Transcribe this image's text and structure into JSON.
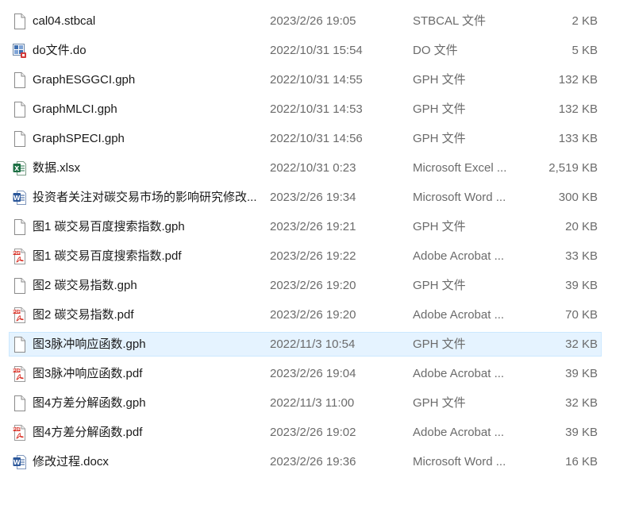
{
  "files": [
    {
      "name": "cal04.stbcal",
      "date": "2023/2/26 19:05",
      "type": "STBCAL 文件",
      "size": "2 KB",
      "icon": "generic-file-icon",
      "selected": false
    },
    {
      "name": "do文件.do",
      "date": "2022/10/31 15:54",
      "type": "DO 文件",
      "size": "5 KB",
      "icon": "stata-do-file-icon",
      "selected": false
    },
    {
      "name": "GraphESGGCI.gph",
      "date": "2022/10/31 14:55",
      "type": "GPH 文件",
      "size": "132 KB",
      "icon": "generic-file-icon",
      "selected": false
    },
    {
      "name": "GraphMLCI.gph",
      "date": "2022/10/31 14:53",
      "type": "GPH 文件",
      "size": "132 KB",
      "icon": "generic-file-icon",
      "selected": false
    },
    {
      "name": "GraphSPECI.gph",
      "date": "2022/10/31 14:56",
      "type": "GPH 文件",
      "size": "133 KB",
      "icon": "generic-file-icon",
      "selected": false
    },
    {
      "name": "数据.xlsx",
      "date": "2022/10/31 0:23",
      "type": "Microsoft Excel ...",
      "size": "2,519 KB",
      "icon": "excel-file-icon",
      "selected": false
    },
    {
      "name": "投资者关注对碳交易市场的影响研究修改...",
      "date": "2023/2/26 19:34",
      "type": "Microsoft Word ...",
      "size": "300 KB",
      "icon": "word-file-icon",
      "selected": false
    },
    {
      "name": "图1 碳交易百度搜索指数.gph",
      "date": "2023/2/26 19:21",
      "type": "GPH 文件",
      "size": "20 KB",
      "icon": "generic-file-icon",
      "selected": false
    },
    {
      "name": "图1 碳交易百度搜索指数.pdf",
      "date": "2023/2/26 19:22",
      "type": "Adobe Acrobat ...",
      "size": "33 KB",
      "icon": "pdf-file-icon",
      "selected": false
    },
    {
      "name": "图2 碳交易指数.gph",
      "date": "2023/2/26 19:20",
      "type": "GPH 文件",
      "size": "39 KB",
      "icon": "generic-file-icon",
      "selected": false
    },
    {
      "name": "图2 碳交易指数.pdf",
      "date": "2023/2/26 19:20",
      "type": "Adobe Acrobat ...",
      "size": "70 KB",
      "icon": "pdf-file-icon",
      "selected": false
    },
    {
      "name": "图3脉冲响应函数.gph",
      "date": "2022/11/3 10:54",
      "type": "GPH 文件",
      "size": "32 KB",
      "icon": "generic-file-icon",
      "selected": true
    },
    {
      "name": "图3脉冲响应函数.pdf",
      "date": "2023/2/26 19:04",
      "type": "Adobe Acrobat ...",
      "size": "39 KB",
      "icon": "pdf-file-icon",
      "selected": false
    },
    {
      "name": "图4方差分解函数.gph",
      "date": "2022/11/3 11:00",
      "type": "GPH 文件",
      "size": "32 KB",
      "icon": "generic-file-icon",
      "selected": false
    },
    {
      "name": "图4方差分解函数.pdf",
      "date": "2023/2/26 19:02",
      "type": "Adobe Acrobat ...",
      "size": "39 KB",
      "icon": "pdf-file-icon",
      "selected": false
    },
    {
      "name": "修改过程.docx",
      "date": "2023/2/26 19:36",
      "type": "Microsoft Word ...",
      "size": "16 KB",
      "icon": "word-file-icon",
      "selected": false
    }
  ],
  "colors": {
    "selection_bg": "#e5f3ff",
    "selection_border": "#cce8ff",
    "excel_green": "#1d7044",
    "word_blue": "#2b579a",
    "pdf_red": "#d93025"
  }
}
